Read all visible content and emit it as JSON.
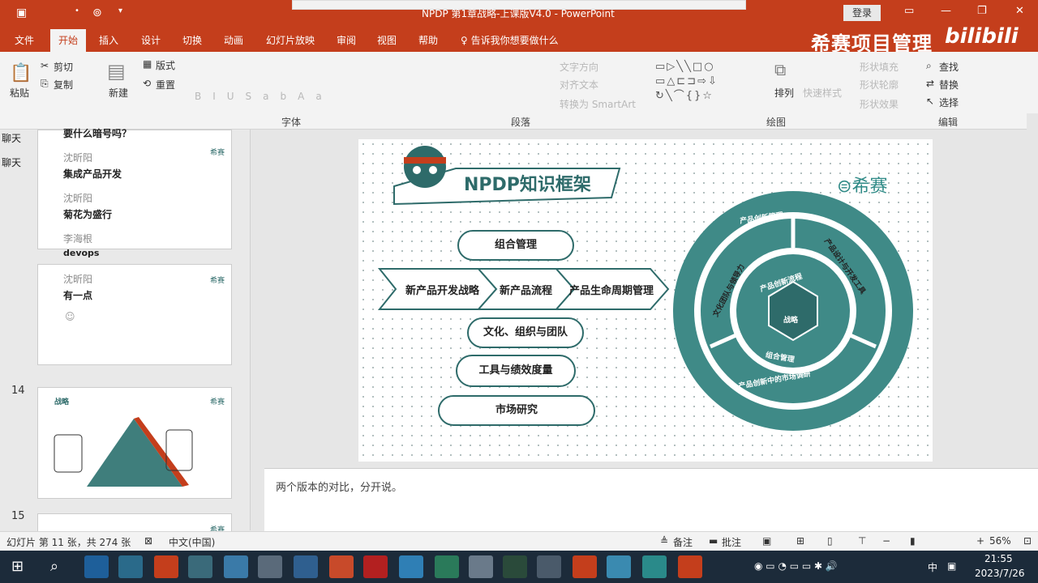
{
  "window": {
    "title": "NPDP 第1章战略-上课版V4.0  -  PowerPoint",
    "login": "登录"
  },
  "tabs": [
    "文件",
    "开始",
    "插入",
    "设计",
    "切换",
    "动画",
    "幻灯片放映",
    "审阅",
    "视图",
    "帮助",
    "告诉我你想要做什么"
  ],
  "active_tab": "开始",
  "brand": {
    "text": "希赛项目管理",
    "bili": "bilibili"
  },
  "ribbon": {
    "clipboard": {
      "paste": "粘贴",
      "cut": "剪切",
      "copy": "复制"
    },
    "slides": {
      "new": "新建",
      "layout": "版式",
      "reset": "重置"
    },
    "paragraph_dim": [
      "转换为 SmartArt",
      "对齐文本",
      "文字方向"
    ],
    "arrange": "排列",
    "quick_styles": "快速样式",
    "shape_fill": "形状填充",
    "shape_outline": "形状轮廓",
    "shape_effect": "形状效果",
    "editing": {
      "find": "查找",
      "replace": "替换",
      "select": "选择"
    },
    "groups": [
      "字体",
      "段落",
      "绘图",
      "编辑"
    ]
  },
  "chat": [
    {
      "text": "聊天"
    },
    {
      "text": "聊天"
    },
    {
      "name": "",
      "msg": "要什么暗号吗？"
    },
    {
      "name": "沈昕阳",
      "msg": "集成产品开发"
    },
    {
      "name": "沈昕阳",
      "msg": "菊花为盛行"
    },
    {
      "name": "李海根",
      "msg": "devops"
    },
    {
      "name": "沈昕阳",
      "msg": "有一点"
    }
  ],
  "thumbnails": [
    {
      "num": "14",
      "tag": "战略"
    },
    {
      "num": "15",
      "tag": ""
    }
  ],
  "thumb_logo": "希赛",
  "slide": {
    "title": "NPDP知识框架",
    "logo": "希赛",
    "pills": [
      "组合管理",
      "文化、组织与团队",
      "工具与绩效度量",
      "市场研究"
    ],
    "arrows": [
      "新产品开发战略",
      "新产品流程",
      "产品生命周期管理"
    ],
    "ring_outer": [
      "产品创新管理",
      "产品设计与开发工具",
      "产品创新中的市场调研",
      "文化团队与领导力"
    ],
    "ring_inner": [
      "产品创新流程",
      "组合管理"
    ],
    "ring_center": "战略"
  },
  "notes": "两个版本的对比，分开说。",
  "status": {
    "slide_info": "幻灯片 第 11 张，共 274 张",
    "language": "中文(中国)",
    "notes_btn": "备注",
    "comments_btn": "批注",
    "zoom": "56%"
  },
  "tray": {
    "ime": "中",
    "time": "21:55",
    "date": "2023/7/26"
  },
  "colors": {
    "accent": "#c43e1c",
    "teal": "#2e6b6a",
    "taskbar": "#1c2b3a"
  }
}
